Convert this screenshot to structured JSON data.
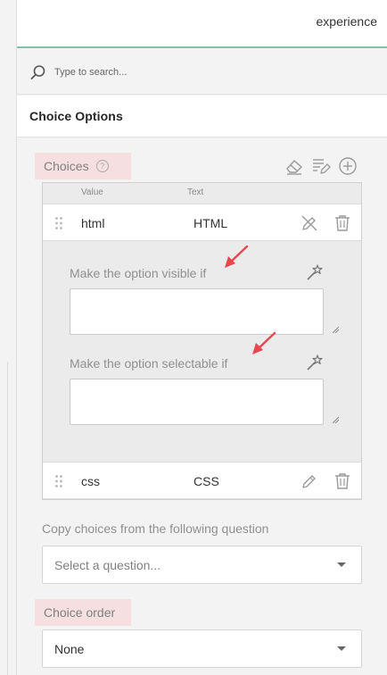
{
  "topbar": {
    "tab_label": "experience"
  },
  "search": {
    "placeholder": "Type to search..."
  },
  "section": {
    "title": "Choice Options"
  },
  "choices": {
    "label": "Choices",
    "help_glyph": "?",
    "columns": {
      "value": "Value",
      "text": "Text"
    },
    "items": [
      {
        "value": "html",
        "text": "HTML",
        "expanded": true,
        "visible_if_label": "Make the option visible if",
        "visible_if_value": "",
        "selectable_if_label": "Make the option selectable if",
        "selectable_if_value": ""
      },
      {
        "value": "css",
        "text": "CSS",
        "expanded": false
      }
    ]
  },
  "copy_choices": {
    "label": "Copy choices from the following question",
    "placeholder": "Select a question..."
  },
  "choice_order": {
    "label": "Choice order",
    "selected": "None"
  },
  "colors": {
    "accent": "#7dc6a9",
    "highlight": "#f6dfe0",
    "arrow": "#e8474f"
  }
}
